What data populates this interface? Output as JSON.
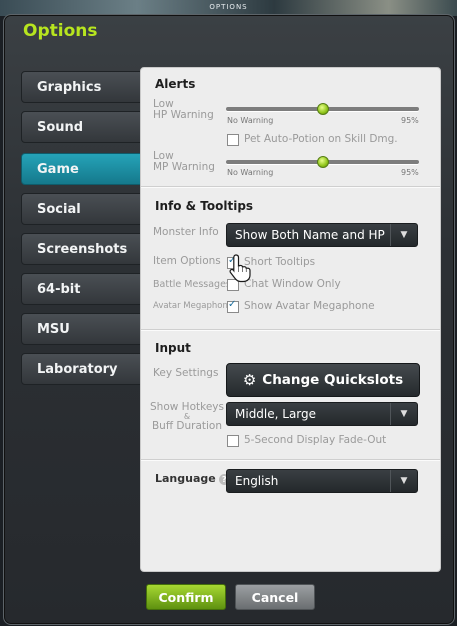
{
  "top_bar": {
    "title": "OPTIONS"
  },
  "window": {
    "title": "Options"
  },
  "nav": {
    "items": [
      {
        "label": "Graphics",
        "active": false
      },
      {
        "label": "Sound",
        "active": false
      },
      {
        "label": "Game",
        "active": true
      },
      {
        "label": "Social",
        "active": false
      },
      {
        "label": "Screenshots",
        "active": false
      },
      {
        "label": "64-bit",
        "active": false
      },
      {
        "label": "MSU",
        "active": false
      },
      {
        "label": "Laboratory",
        "active": false
      }
    ]
  },
  "alerts": {
    "title": "Alerts",
    "hp": {
      "label_top": "Low",
      "label_bottom": "HP Warning",
      "min_label": "No Warning",
      "max_label": "95%",
      "value_fraction": 0.5
    },
    "pet_potion": {
      "label": "Pet Auto-Potion on Skill Dmg.",
      "checked": false
    },
    "mp": {
      "label_top": "Low",
      "label_bottom": "MP Warning",
      "min_label": "No Warning",
      "max_label": "95%",
      "value_fraction": 0.5
    }
  },
  "info": {
    "title": "Info & Tooltips",
    "monster_info": {
      "label": "Monster Info",
      "value": "Show Both Name and HP"
    },
    "item_options": {
      "label": "Item Options",
      "option": "Short Tooltips",
      "checked": true
    },
    "battle_messages": {
      "label": "Battle Messages",
      "option": "Chat Window Only",
      "checked": false
    },
    "avatar_megaphone": {
      "label": "Avatar Megaphone",
      "option": "Show Avatar Megaphone",
      "checked": true
    }
  },
  "input": {
    "title": "Input",
    "key_settings": {
      "label": "Key Settings",
      "button": "Change Quickslots"
    },
    "hotkeys": {
      "label_line1": "Show Hotkeys",
      "label_line2": "&",
      "label_line3": "Buff Duration",
      "value": "Middle, Large"
    },
    "fade_out": {
      "label": "5-Second Display Fade-Out",
      "checked": false
    }
  },
  "language": {
    "label": "Language",
    "help": "?",
    "value": "English"
  },
  "footer": {
    "confirm": "Confirm",
    "cancel": "Cancel"
  },
  "colors": {
    "accent_green": "#b7e51f",
    "active_tab": "#1f8fa3"
  }
}
